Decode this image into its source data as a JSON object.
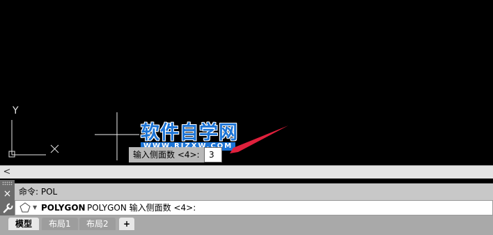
{
  "canvas": {
    "ucs_y_label": "Y",
    "watermark": {
      "title": "软件自学网",
      "url": "WWW.RJZXW.COM"
    },
    "dynamic_input": {
      "prompt": "输入侧面数 <4>:",
      "value": "3"
    },
    "colors": {
      "background": "#000000",
      "watermark_blue": "#1c74d6",
      "arrow_red": "#e0203c"
    }
  },
  "scrollbar": {
    "left_arrow": "<"
  },
  "command": {
    "close_glyph": "×",
    "history": "命令:  POL",
    "current_name": "POLYGON",
    "current_rest": "POLYGON 输入侧面数 <4>:",
    "icon": "polygon-icon"
  },
  "tabs": [
    {
      "label": "模型",
      "active": true
    },
    {
      "label": "布局1",
      "active": false
    },
    {
      "label": "布局2",
      "active": false
    },
    {
      "label": "+",
      "active": false
    }
  ]
}
